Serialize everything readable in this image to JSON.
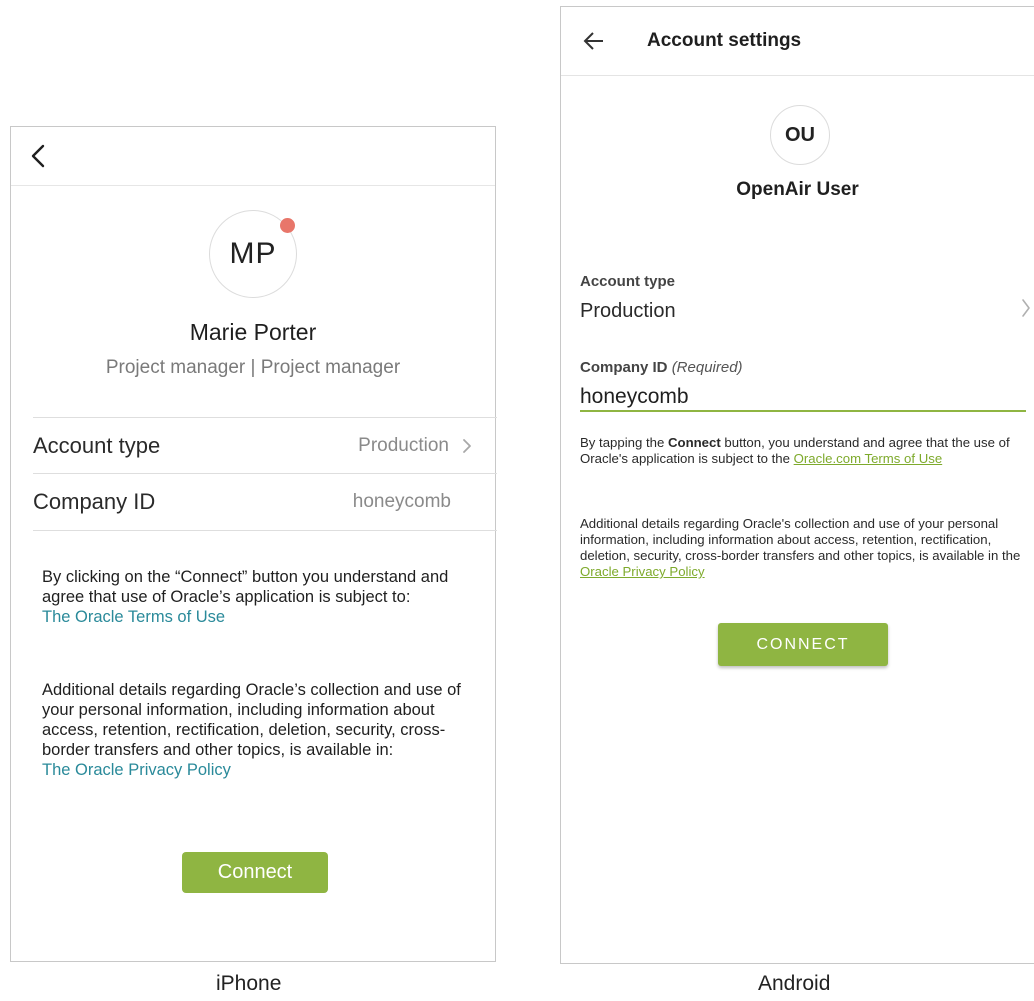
{
  "iphone": {
    "avatar_initials": "MP",
    "name": "Marie Porter",
    "role": "Project manager | Project manager",
    "rows": [
      {
        "label": "Account type",
        "value": "Production"
      },
      {
        "label": "Company ID",
        "value": "honeycomb"
      }
    ],
    "terms_text": "By clicking on the “Connect” button you understand and agree that use of Oracle’s application is subject to:",
    "terms_link": "The Oracle Terms of Use",
    "privacy_text": "Additional details regarding Oracle’s collection and use of your personal information, including information about access, retention, rectification, deletion, security, cross-border transfers and other topics, is available in:",
    "privacy_link": "The Oracle Privacy Policy",
    "connect_label": "Connect",
    "caption": "iPhone"
  },
  "android": {
    "title": "Account settings",
    "avatar_initials": "OU",
    "name": "OpenAir User",
    "account_type_label": "Account type",
    "account_type_value": "Production",
    "company_id_label": "Company ID",
    "company_id_required": "(Required)",
    "company_id_value": "honeycomb",
    "terms_prefix": "By tapping the ",
    "terms_bold": "Connect",
    "terms_middle": " button, you understand and agree that the use of Oracle's application is subject to the ",
    "terms_link": "Oracle.com Terms of Use",
    "privacy_text": "Additional details regarding Oracle's collection and use of your personal information, including information about access, retention, rectification, deletion, security, cross-border transfers and other topics, is available in the ",
    "privacy_link": "Oracle Privacy Policy",
    "connect_label": "CONNECT",
    "caption": "Android"
  },
  "colors": {
    "accent_green": "#8fb542",
    "ios_link_teal": "#2a8a9a",
    "android_link_green": "#7eaa2c",
    "notification_dot": "#e8766a"
  }
}
